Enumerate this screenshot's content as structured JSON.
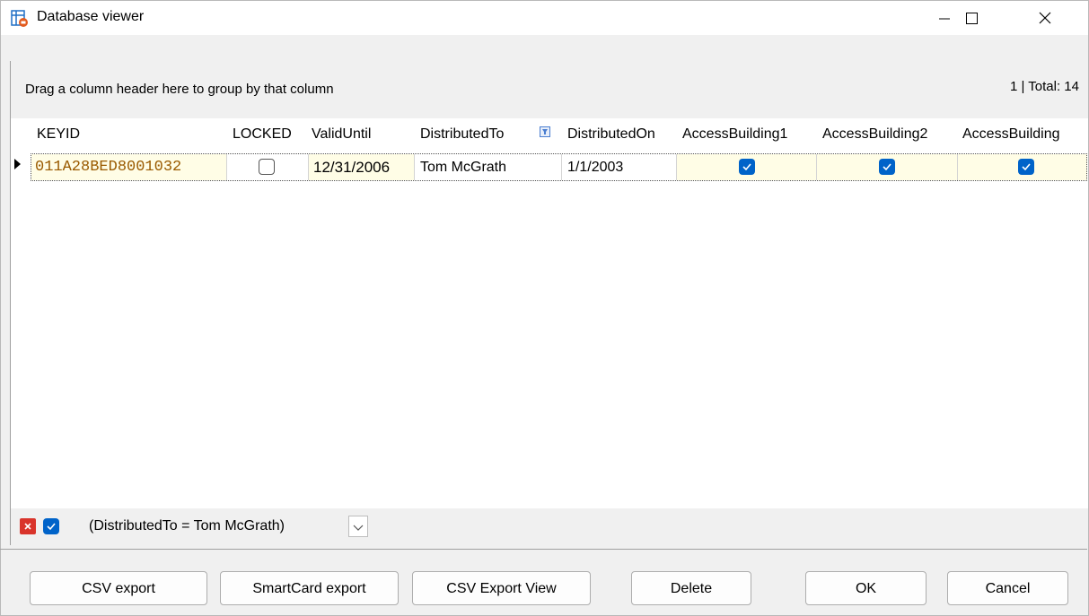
{
  "window": {
    "title": "Database viewer"
  },
  "grid": {
    "group_hint": "Drag a column header here to group by that column",
    "total": "1 | Total: 14",
    "columns": [
      "KEYID",
      "LOCKED",
      "ValidUntil",
      "DistributedTo",
      "DistributedOn",
      "AccessBuilding1",
      "AccessBuilding2",
      "AccessBuilding"
    ],
    "row": {
      "keyid": "011A28BED8001032",
      "locked": false,
      "valid_until": "12/31/2006",
      "distributed_to": "Tom McGrath",
      "distributed_on": "1/1/2003",
      "access_building1": true,
      "access_building2": true,
      "access_building3": true
    }
  },
  "filter": {
    "text": "(DistributedTo = Tom McGrath)",
    "enabled": true
  },
  "buttons": {
    "csv_export": "CSV export",
    "smartcard_export": "SmartCard export",
    "csv_export_view": "CSV Export View",
    "delete": "Delete",
    "ok": "OK",
    "cancel": "Cancel"
  },
  "colors": {
    "accent": "#0063c9",
    "highlight_row": "#fffde6",
    "key_text": "#9a5a00",
    "filter_close": "#d9342b"
  }
}
